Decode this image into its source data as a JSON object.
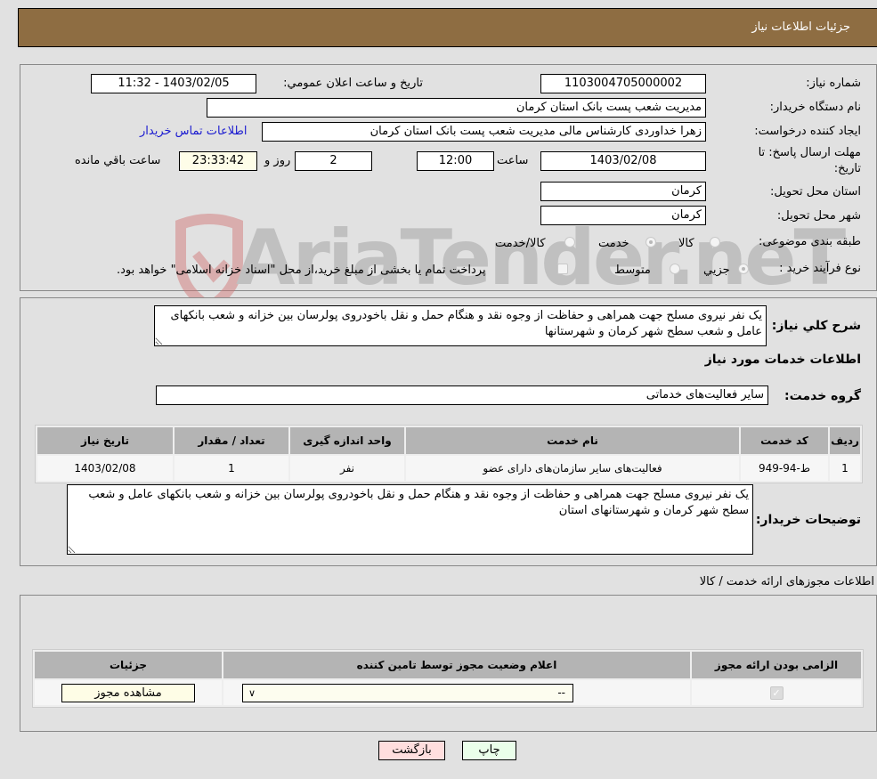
{
  "header": {
    "title": "جزئیات اطلاعات نیاز"
  },
  "form": {
    "need_number": {
      "label": "شماره نیاز:",
      "value": "1103004705000002"
    },
    "announce_datetime": {
      "label": "تاریخ و ساعت اعلان عمومي:",
      "value": "1403/02/05 - 11:32"
    },
    "buyer_org": {
      "label": "نام دستگاه خریدار:",
      "value": "مدیریت شعب پست بانک استان کرمان"
    },
    "requester": {
      "label": "ایجاد کننده درخواست:",
      "value": "زهرا خداوردی  کارشناس مالی  مدیریت شعب پست بانک استان کرمان"
    },
    "buyer_contact_link": "اطلاعات تماس خریدار",
    "deadline": {
      "label_line1": "مهلت ارسال پاسخ: تا",
      "label_line2": "تاریخ:",
      "date": "1403/02/08",
      "time_label": "ساعت",
      "time": "12:00",
      "days": "2",
      "days_label": "روز و",
      "remaining": "23:33:42",
      "remaining_label": "ساعت باقي مانده"
    },
    "delivery_province": {
      "label": "استان محل تحویل:",
      "value": "کرمان"
    },
    "delivery_city": {
      "label": "شهر محل تحویل:",
      "value": "کرمان"
    },
    "category": {
      "label": "طبقه بندی موضوعی:",
      "options": [
        "کالا",
        "خدمت",
        "کالا/خدمت"
      ],
      "selected": "خدمت"
    },
    "purchase_type": {
      "label": "نوع فرآیند خرید :",
      "options": [
        "جزيي",
        "متوسط"
      ],
      "selected": "جزيي",
      "treasury_note": "پرداخت تمام یا بخشی از مبلغ خرید،از محل \"اسناد خزانه اسلامی\" خواهد بود."
    }
  },
  "description": {
    "label": "شرح کلي نياز:",
    "value": "یک نفر نیروی مسلح جهت همراهی و حفاظت از وجوه نقد و هنگام حمل و نقل باخودروی پولرسان بین خزانه و شعب بانکهای عامل و شعب سطح شهر کرمان و شهرستانها"
  },
  "services": {
    "section_title": "اطلاعات خدمات مورد نياز",
    "group_label": "گروه خدمت:",
    "group_value": "سایر فعالیت‌های خدماتی",
    "table": {
      "headers": [
        "رديف",
        "کد خدمت",
        "نام خدمت",
        "واحد اندازه گيری",
        "تعداد / مقدار",
        "تاريخ نياز"
      ],
      "rows": [
        [
          "1",
          "ط-94-949",
          "فعالیت‌های سایر سازمان‌های دارای عضو",
          "نفر",
          "1",
          "1403/02/08"
        ]
      ]
    }
  },
  "buyer_notes": {
    "label": "توضيحات خريدار:",
    "value": "یک نفر نیروی مسلح جهت همراهی و حفاظت از وجوه نقد و هنگام حمل و نقل باخودروی پولرسان بین خزانه و شعب بانکهای عامل و شعب سطح شهر کرمان و شهرستانهای استان"
  },
  "permits": {
    "section_title": "اطلاعات مجوزهای ارائه خدمت / کالا",
    "headers": [
      "الزامی بودن ارائه مجوز",
      "اعلام وضعیت مجوز توسط تامين کننده",
      "جزئیات"
    ],
    "row": {
      "required_checked": true,
      "status_value": "--",
      "view_button": "مشاهده مجوز"
    }
  },
  "footer": {
    "print_button": "چاپ",
    "back_button": "بازگشت"
  },
  "colors": {
    "header_bg": "#8e6d42",
    "print_bg": "#eaffea",
    "back_bg": "#ffdede",
    "link": "#1a1ad0"
  },
  "watermark": {
    "text": "AriaTender.neT"
  }
}
